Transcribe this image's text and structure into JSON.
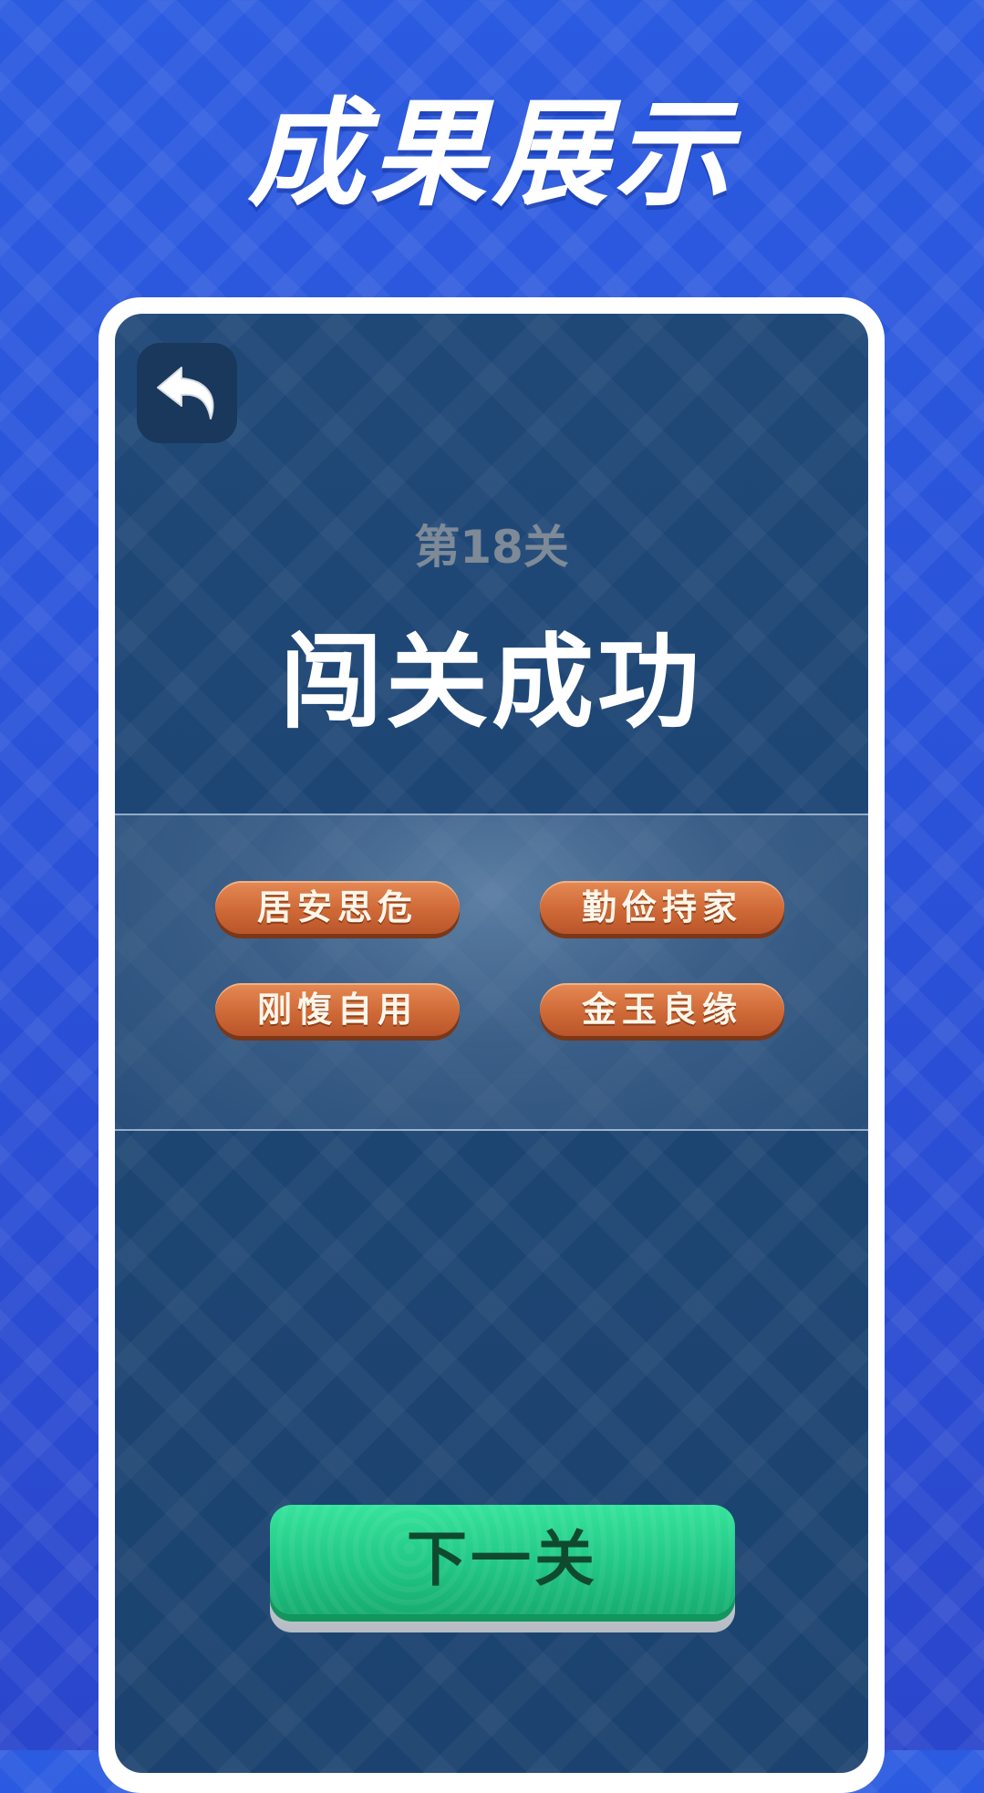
{
  "headline": "成果展示",
  "back_button": {
    "icon": "back-arrow-icon"
  },
  "level": {
    "label": "第18关"
  },
  "result": {
    "title": "闯关成功"
  },
  "idioms": [
    {
      "text": "居安思危"
    },
    {
      "text": "勤俭持家"
    },
    {
      "text": "刚愎自用"
    },
    {
      "text": "金玉良缘"
    }
  ],
  "next_button": {
    "label": "下一关"
  },
  "colors": {
    "background": "#2a55d8",
    "screen": "#1d4470",
    "pill": "#cf6a37",
    "next_button": "#22c785",
    "level_text": "#7e8a97"
  }
}
